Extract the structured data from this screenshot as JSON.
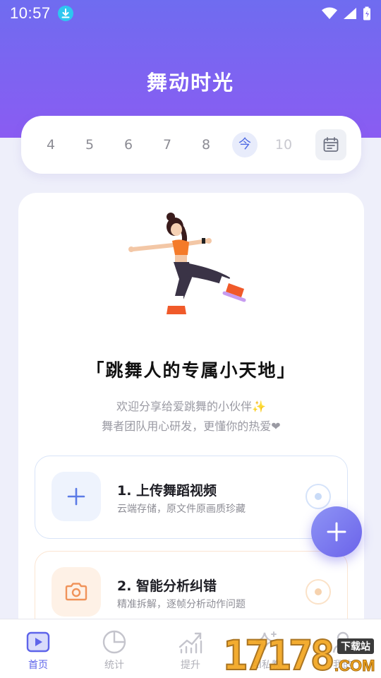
{
  "status_bar": {
    "time": "10:57"
  },
  "app": {
    "title": "舞动时光"
  },
  "dates": [
    {
      "label": "4",
      "state": "past"
    },
    {
      "label": "5",
      "state": "past"
    },
    {
      "label": "6",
      "state": "past"
    },
    {
      "label": "7",
      "state": "past"
    },
    {
      "label": "8",
      "state": "past"
    },
    {
      "label": "今",
      "state": "today"
    },
    {
      "label": "10",
      "state": "future"
    }
  ],
  "intro": {
    "heading": "「跳舞人的专属小天地」",
    "line1": "欢迎分享给爱跳舞的小伙伴✨",
    "line2": "舞者团队用心研发，更懂你的热爱❤"
  },
  "steps": [
    {
      "title": "1. 上传舞蹈视频",
      "desc": "云端存储，原文件原画质珍藏",
      "icon": "plus-icon",
      "accent": "#5b7be6"
    },
    {
      "title": "2. 智能分析纠错",
      "desc": "精准拆解，逐帧分析动作问题",
      "icon": "camera-icon",
      "accent": "#f0935a"
    }
  ],
  "tabs": [
    {
      "label": "首页",
      "icon": "video-play-icon",
      "active": true
    },
    {
      "label": "统计",
      "icon": "pie-chart-icon",
      "active": false
    },
    {
      "label": "提升",
      "icon": "growth-chart-icon",
      "active": false
    },
    {
      "label": "AI私教",
      "icon": "sparkle-icon",
      "active": false
    },
    {
      "label": "我的",
      "icon": "user-icon",
      "active": false
    }
  ],
  "watermark": {
    "number": "17178",
    "tag": "下载站",
    "domain": ".COM"
  },
  "colors": {
    "primary": "#6f6cf0",
    "accent_orange": "#f0935a",
    "tab_active": "#5e64ea"
  }
}
